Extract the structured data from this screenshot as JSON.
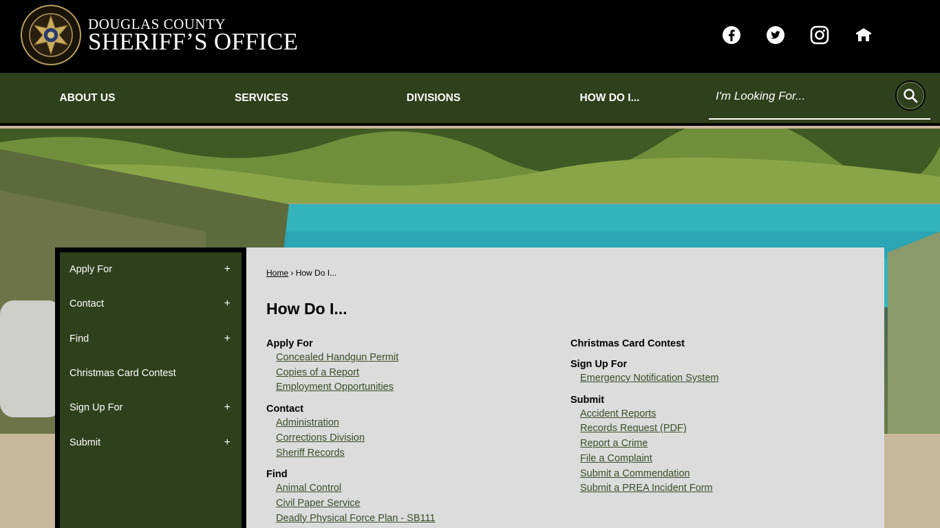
{
  "header": {
    "brand_line1": "DOUGLAS COUNTY",
    "brand_line2": "SHERIFF’S OFFICE",
    "logo_text_top": "DOUGLAS COUNTY",
    "logo_text_bottom": "SHERIFF'S OFFICE",
    "social_icons": [
      "facebook-icon",
      "twitter-icon",
      "instagram-icon",
      "nextdoor-icon"
    ]
  },
  "nav": {
    "items": [
      "ABOUT US",
      "SERVICES",
      "DIVISIONS",
      "HOW DO I..."
    ],
    "search_placeholder": "I'm Looking For..."
  },
  "sidebar": {
    "items": [
      {
        "label": "Apply For",
        "expand": "+"
      },
      {
        "label": "Contact",
        "expand": "+"
      },
      {
        "label": "Find",
        "expand": "+"
      },
      {
        "label": "Christmas Card Contest",
        "expand": ""
      },
      {
        "label": "Sign Up For",
        "expand": "+"
      },
      {
        "label": "Submit",
        "expand": "+"
      }
    ]
  },
  "breadcrumb": {
    "home": "Home",
    "separator": "›",
    "current": "How Do I..."
  },
  "page_title": "How Do I...",
  "left_column": {
    "apply_for": {
      "title": "Apply For",
      "links": [
        "Concealed Handgun Permit",
        "Copies of a Report",
        "Employment Opportunities"
      ]
    },
    "contact": {
      "title": "Contact",
      "links": [
        "Administration",
        "Corrections Division",
        "Sheriff Records"
      ]
    },
    "find": {
      "title": "Find",
      "links": [
        "Animal Control",
        "Civil Paper Service",
        "Deadly Physical Force Plan - SB111"
      ]
    }
  },
  "right_column": {
    "christmas": {
      "title": "Christmas Card Contest"
    },
    "sign_up": {
      "title": "Sign Up For",
      "links": [
        "Emergency Notification System"
      ]
    },
    "submit": {
      "title": "Submit",
      "links": [
        "Accident Reports",
        "Records Request (PDF)",
        "Report a Crime",
        "File a Complaint",
        "Submit a Commendation",
        "Submit a PREA Incident Form"
      ]
    }
  },
  "colors": {
    "nav_green": "#2e401c",
    "link_green": "#3a4d26",
    "content_bg": "#dcdcdc",
    "page_bg": "#c8b89c"
  }
}
